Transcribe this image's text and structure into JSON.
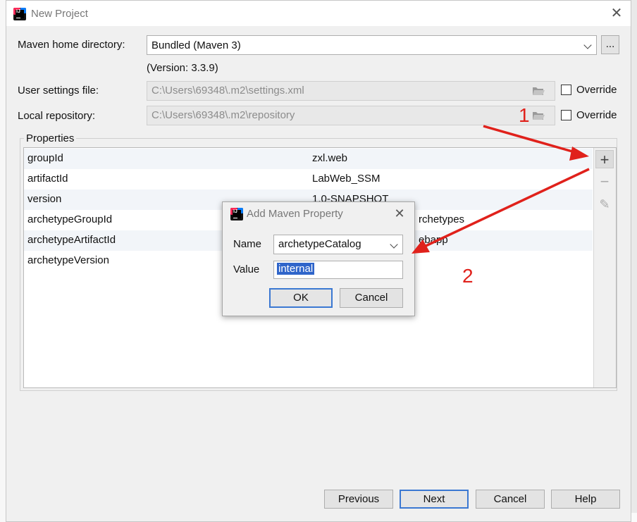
{
  "window": {
    "title": "New Project",
    "close_glyph": "✕"
  },
  "maven_home": {
    "label": "Maven home directory:",
    "value": "Bundled (Maven 3)",
    "browse_label": "...",
    "version": "(Version: 3.3.9)"
  },
  "user_settings": {
    "label": "User settings file:",
    "value": "C:\\Users\\69348\\.m2\\settings.xml",
    "override_label": "Override"
  },
  "local_repo": {
    "label": "Local repository:",
    "value": "C:\\Users\\69348\\.m2\\repository",
    "override_label": "Override"
  },
  "properties": {
    "title": "Properties",
    "rows": [
      {
        "key": "groupId",
        "value": "zxl.web"
      },
      {
        "key": "artifactId",
        "value": "LabWeb_SSM"
      },
      {
        "key": "version",
        "value": "1.0-SNAPSHOT"
      },
      {
        "key": "archetypeGroupId",
        "value": "rchetypes"
      },
      {
        "key": "archetypeArtifactId",
        "value": "ebapp"
      },
      {
        "key": "archetypeVersion",
        "value": ""
      }
    ],
    "toolbar": {
      "add": "+",
      "remove": "−",
      "edit": "✎"
    }
  },
  "dialog": {
    "title": "Add Maven Property",
    "close_glyph": "✕",
    "name_label": "Name",
    "name_value": "archetypeCatalog",
    "value_label": "Value",
    "value_value": "internal",
    "ok": "OK",
    "cancel": "Cancel"
  },
  "annotations": {
    "one": "1",
    "two": "2",
    "color": "#e0211b"
  },
  "footer": {
    "previous": "Previous",
    "next": "Next",
    "cancel": "Cancel",
    "help": "Help"
  },
  "colors": {
    "accent": "#3b78d2",
    "selection": "#2f65ca"
  },
  "icons": [
    "intellij-logo-icon",
    "close-icon",
    "chevron-down-icon",
    "folder-open-icon",
    "plus-icon",
    "minus-icon",
    "pencil-icon"
  ]
}
